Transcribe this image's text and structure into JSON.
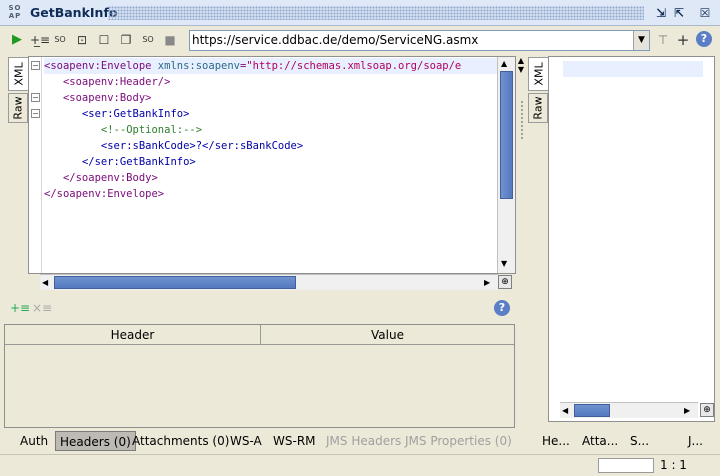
{
  "window": {
    "title": "GetBankInfo",
    "soap_icon": "SO AP"
  },
  "toolbar": {
    "url": "https://service.ddbac.de/demo/ServiceNG.asmx"
  },
  "request_tabs": [
    "XML",
    "Raw"
  ],
  "response_tabs": [
    "XML",
    "Raw"
  ],
  "editor": {
    "lines": [
      {
        "indent": "",
        "open": "<soapenv:Envelope ",
        "attr": "xmlns:soapenv",
        "eq": "=",
        "val": "\"http://schemas.xmlsoap.org/soap/e"
      },
      {
        "indent": "   ",
        "text": "<soapenv:Header/>"
      },
      {
        "indent": "   ",
        "text": "<soapenv:Body>"
      },
      {
        "indent": "      ",
        "text": "<ser:GetBankInfo>"
      },
      {
        "indent": "         ",
        "text": "<!--Optional:-->"
      },
      {
        "indent": "         ",
        "text": "<ser:sBankCode>?</ser:sBankCode>"
      },
      {
        "indent": "      ",
        "text": "</ser:GetBankInfo>"
      },
      {
        "indent": "   ",
        "text": "</soapenv:Body>"
      },
      {
        "indent": "",
        "text": "</soapenv:Envelope>"
      }
    ]
  },
  "headers_table": {
    "columns": [
      "Header",
      "Value"
    ]
  },
  "bottom_tabs": [
    {
      "label": "Auth",
      "state": "normal"
    },
    {
      "label": "Headers (0)",
      "state": "active"
    },
    {
      "label": "Attachments (0)",
      "state": "normal"
    },
    {
      "label": "WS-A",
      "state": "normal"
    },
    {
      "label": "WS-RM",
      "state": "normal"
    },
    {
      "label": "JMS Headers",
      "state": "disabled"
    },
    {
      "label": "JMS Properties (0)",
      "state": "disabled"
    }
  ],
  "response_bottom_tabs": [
    "He...",
    "Atta...",
    "S...",
    "J..."
  ],
  "status": {
    "position": "1 : 1"
  },
  "colors": {
    "accent": "#5478be",
    "title_text": "#0d2d57"
  }
}
